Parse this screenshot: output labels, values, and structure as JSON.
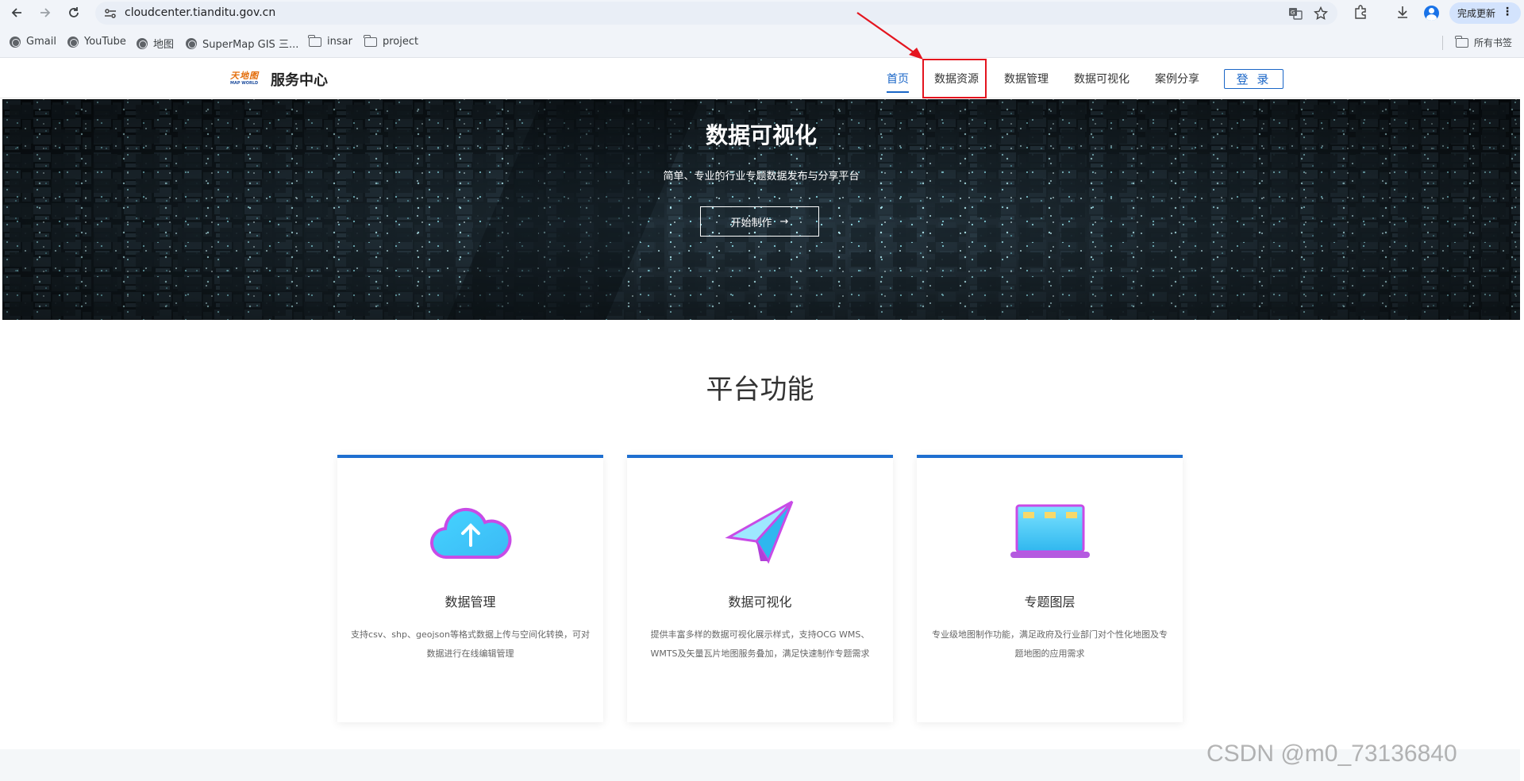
{
  "browser": {
    "url": "cloudcenter.tianditu.gov.cn",
    "update_label": "完成更新",
    "more_label": "⋮",
    "bookmarks": [
      {
        "label": "Gmail",
        "icon": "globe-icon"
      },
      {
        "label": "YouTube",
        "icon": "globe-icon"
      },
      {
        "label": "地图",
        "icon": "globe-icon"
      },
      {
        "label": "SuperMap GIS 三...",
        "icon": "globe-icon"
      },
      {
        "label": "insar",
        "icon": "folder-icon"
      },
      {
        "label": "project",
        "icon": "folder-icon"
      }
    ],
    "all_bookmarks": "所有书签"
  },
  "header": {
    "logo_text": "天地图",
    "logo_sub": "MAP WORLD",
    "brand": "服务中心",
    "menu": [
      "首页",
      "数据资源",
      "数据管理",
      "数据可视化",
      "案例分享"
    ],
    "active_index": 0,
    "login": "登 录",
    "highlight_color": "#e4151f",
    "accent_color": "#1a66c7"
  },
  "banner": {
    "title": "数据可视化",
    "subtitle": "简单、专业的行业专题数据发布与分享平台",
    "cta": "开始制作",
    "cta_arrow": "→"
  },
  "features": {
    "title": "平台功能",
    "cards": [
      {
        "icon": "cloud-upload-icon",
        "title": "数据管理",
        "desc": "支持csv、shp、geojson等格式数据上传与空间化转换，可对数据进行在线编辑管理"
      },
      {
        "icon": "paper-plane-icon",
        "title": "数据可视化",
        "desc": "提供丰富多样的数据可视化展示样式，支持OCG WMS、WMTS及矢量瓦片地图服务叠加，满足快速制作专题需求"
      },
      {
        "icon": "laptop-icon",
        "title": "专题图层",
        "desc": "专业级地图制作功能，满足政府及行业部门对个性化地图及专题地图的应用需求"
      }
    ]
  },
  "watermark": "CSDN @m0_73136840"
}
